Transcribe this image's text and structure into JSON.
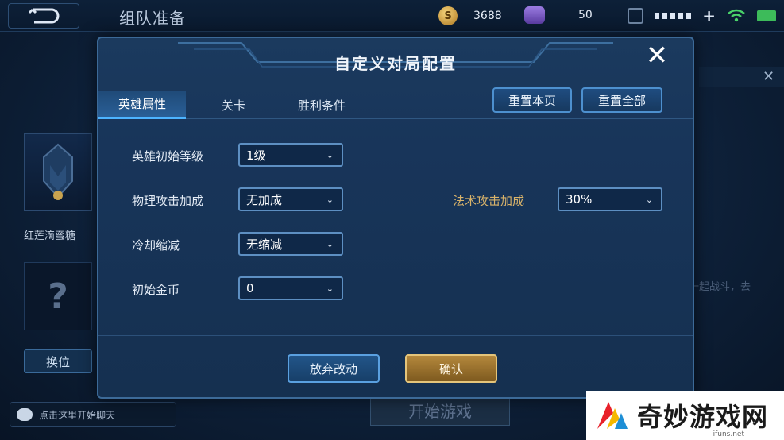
{
  "topbar": {
    "title": "组队准备",
    "coins": "3688",
    "gems": "50",
    "icons": [
      "back-arrow-icon",
      "coin-icon",
      "gem-icon",
      "ticket-icon",
      "plus-icon",
      "wifi-icon",
      "battery-icon"
    ]
  },
  "left": {
    "hero_name": "红莲滴蜜糖",
    "unknown_mark": "?",
    "swap_label": "换位",
    "chat_placeholder": "点击这里开始聊天"
  },
  "right": {
    "hint": "邀请好友一起战斗，去找好友吧！"
  },
  "start_label": "开始游戏",
  "modal": {
    "title": "自定义对局配置",
    "close": "✕",
    "tabs": [
      {
        "label": "英雄属性"
      },
      {
        "label": "关卡"
      },
      {
        "label": "胜利条件"
      }
    ],
    "reset_page": "重置本页",
    "reset_all": "重置全部",
    "rows": [
      {
        "label": "英雄初始等级",
        "value": "1级"
      },
      {
        "label": "物理攻击加成",
        "value": "无加成"
      },
      {
        "label": "冷却缩减",
        "value": "无缩减"
      },
      {
        "label": "初始金币",
        "value": "0"
      },
      {
        "label": "法术攻击加成",
        "value": "30%"
      }
    ],
    "discard": "放弃改动",
    "confirm": "确认"
  },
  "watermark": {
    "text": "奇妙游戏网",
    "url": "ifuns.net"
  },
  "colors": {
    "accent_blue": "#4db4ff",
    "gold": "#d9b36a",
    "modal_bg": "#18355a"
  }
}
